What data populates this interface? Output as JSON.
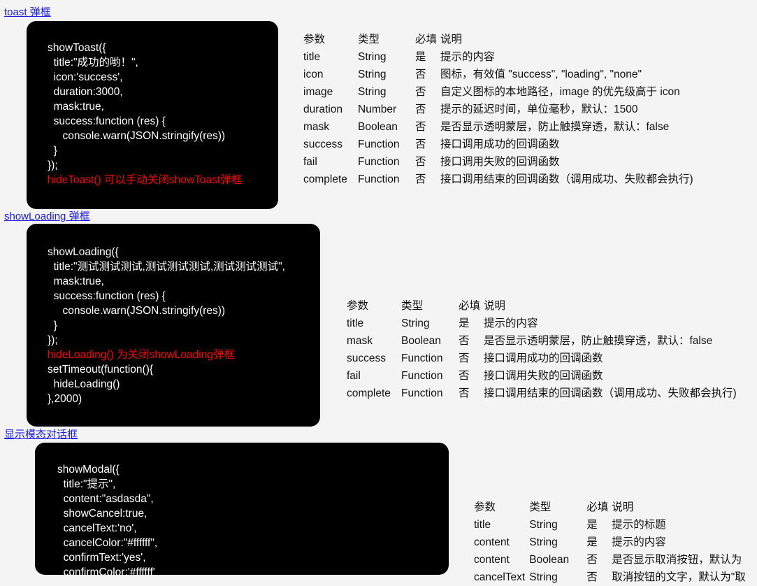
{
  "page": {
    "background_color": "#f4f4f4",
    "link_color": "#1a1ae6",
    "code_background": "#000000",
    "code_text_color": "#ffffff",
    "code_highlight_color": "#ff0000"
  },
  "sections": [
    {
      "link_label": "toast 弹框",
      "code_lines": [
        {
          "text": "showToast({",
          "highlight": false
        },
        {
          "text": "  title:\"成功的哟！\",",
          "highlight": false
        },
        {
          "text": "  icon:'success',",
          "highlight": false
        },
        {
          "text": "  duration:3000,",
          "highlight": false
        },
        {
          "text": "  mask:true,",
          "highlight": false
        },
        {
          "text": "  success:function (res) {",
          "highlight": false
        },
        {
          "text": "     console.warn(JSON.stringify(res))",
          "highlight": false
        },
        {
          "text": "  }",
          "highlight": false
        },
        {
          "text": "});",
          "highlight": false
        },
        {
          "text": "hideToast() 可以手动关闭showToast弹框",
          "highlight": true
        }
      ],
      "table": {
        "headers": [
          "参数",
          "类型",
          "必填",
          "说明"
        ],
        "rows": [
          [
            "title",
            "String",
            "是",
            "提示的内容"
          ],
          [
            "icon",
            "String",
            "否",
            "图标，有效值 \"success\", \"loading\", \"none\""
          ],
          [
            "image",
            "String",
            "否",
            "自定义图标的本地路径，image 的优先级高于 icon"
          ],
          [
            "duration",
            "Number",
            "否",
            "提示的延迟时间，单位毫秒，默认：1500"
          ],
          [
            "mask",
            "Boolean",
            "否",
            "是否显示透明蒙层，防止触摸穿透，默认：false"
          ],
          [
            "success",
            "Function",
            "否",
            "接口调用成功的回调函数"
          ],
          [
            "fail",
            "Function",
            "否",
            "接口调用失败的回调函数"
          ],
          [
            "complete",
            "Function",
            "否",
            "接口调用结束的回调函数（调用成功、失败都会执行)"
          ]
        ]
      }
    },
    {
      "link_label": "showLoading 弹框",
      "code_lines": [
        {
          "text": "showLoading({",
          "highlight": false
        },
        {
          "text": "  title:\"测试测试测试,测试测试测试,测试测试测试\",",
          "highlight": false
        },
        {
          "text": "  mask:true,",
          "highlight": false
        },
        {
          "text": "  success:function (res) {",
          "highlight": false
        },
        {
          "text": "     console.warn(JSON.stringify(res))",
          "highlight": false
        },
        {
          "text": "  }",
          "highlight": false
        },
        {
          "text": "});",
          "highlight": false
        },
        {
          "text": "hideLoading() 为关闭showLoading弹框",
          "highlight": true
        },
        {
          "text": "setTimeout(function(){",
          "highlight": false
        },
        {
          "text": "  hideLoading()",
          "highlight": false
        },
        {
          "text": "},2000)",
          "highlight": false
        }
      ],
      "table": {
        "headers": [
          "参数",
          "类型",
          "必填",
          "说明"
        ],
        "rows": [
          [
            "title",
            "String",
            "是",
            "提示的内容"
          ],
          [
            "mask",
            "Boolean",
            "否",
            "是否显示透明蒙层，防止触摸穿透，默认：false"
          ],
          [
            "success",
            "Function",
            "否",
            "接口调用成功的回调函数"
          ],
          [
            "fail",
            "Function",
            "否",
            "接口调用失败的回调函数"
          ],
          [
            "complete",
            "Function",
            "否",
            "接口调用结束的回调函数（调用成功、失败都会执行)"
          ]
        ]
      }
    },
    {
      "link_label": "显示模态对话框",
      "code_lines": [
        {
          "text": "showModal({",
          "highlight": false
        },
        {
          "text": "  title:\"提示\",",
          "highlight": false
        },
        {
          "text": "  content:\"asdasda\",",
          "highlight": false
        },
        {
          "text": "  showCancel:true,",
          "highlight": false
        },
        {
          "text": "  cancelText:'no',",
          "highlight": false
        },
        {
          "text": "  cancelColor:\"#ffffff\",",
          "highlight": false
        },
        {
          "text": "  confirmText:'yes',",
          "highlight": false
        },
        {
          "text": "  confirmColor:'#ffffff'",
          "highlight": false
        }
      ],
      "table": {
        "headers": [
          "参数",
          "类型",
          "必填",
          "说明"
        ],
        "rows": [
          [
            "title",
            "String",
            "是",
            "提示的标题"
          ],
          [
            "content",
            "String",
            "是",
            "提示的内容"
          ],
          [
            "content",
            "Boolean",
            "否",
            "是否显示取消按钮，默认为"
          ],
          [
            "cancelText",
            "String",
            "否",
            "取消按钮的文字，默认为\"取"
          ]
        ]
      }
    }
  ]
}
